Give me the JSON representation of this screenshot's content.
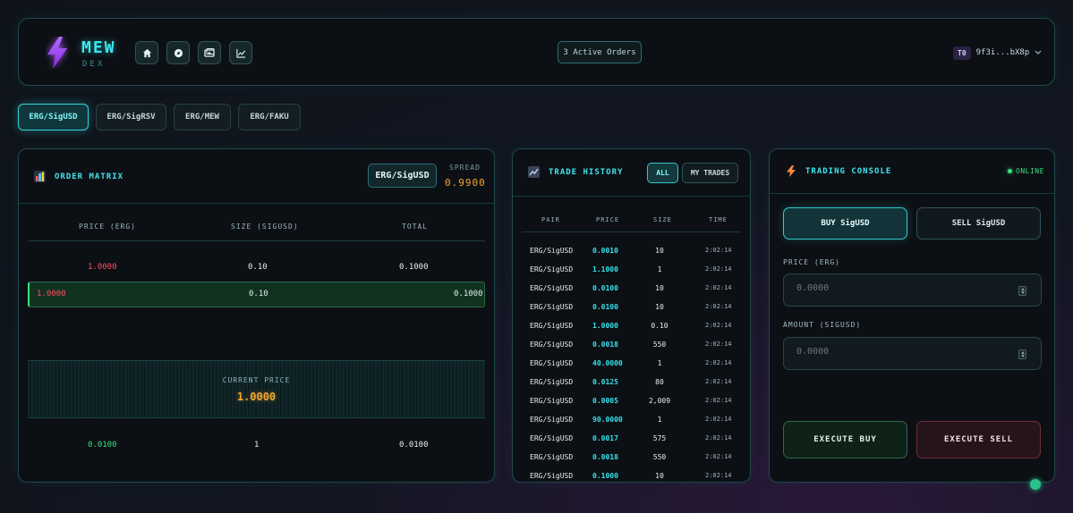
{
  "header": {
    "logo_title": "MEW",
    "logo_subtitle": "DEX",
    "active_orders": "3 Active Orders",
    "wallet_badge": "T0",
    "wallet_address": "9f3i...bX8p",
    "nav_icons": [
      "home-icon",
      "compass-icon",
      "wallet-icon",
      "chart-icon"
    ]
  },
  "pairs": [
    "ERG/SigUSD",
    "ERG/SigRSV",
    "ERG/MEW",
    "ERG/FAKU"
  ],
  "active_pair_index": 0,
  "order_matrix": {
    "title": "ORDER MATRIX",
    "pair": "ERG/SigUSD",
    "spread_label": "SPREAD",
    "spread_value": "0.9900",
    "columns": [
      "PRICE (ERG)",
      "SIZE (SIGUSD)",
      "TOTAL"
    ],
    "asks": [
      {
        "price": "1.0000",
        "size": "0.10",
        "total": "0.1000"
      },
      {
        "price": "1.0000",
        "size": "0.10",
        "total": "0.1000"
      }
    ],
    "current_label": "CURRENT PRICE",
    "current_price": "1.0000",
    "bids": [
      {
        "price": "0.0100",
        "size": "1",
        "total": "0.0100"
      }
    ]
  },
  "trade_history": {
    "title": "TRADE HISTORY",
    "filter_all": "ALL",
    "filter_mine": "MY TRADES",
    "columns": [
      "PAIR",
      "PRICE",
      "SIZE",
      "TIME"
    ],
    "rows": [
      {
        "pair": "ERG/SigUSD",
        "price": "0.0010",
        "size": "10",
        "time": "2:02:14"
      },
      {
        "pair": "ERG/SigUSD",
        "price": "1.1000",
        "size": "1",
        "time": "2:02:14"
      },
      {
        "pair": "ERG/SigUSD",
        "price": "0.0100",
        "size": "10",
        "time": "2:02:14"
      },
      {
        "pair": "ERG/SigUSD",
        "price": "0.0100",
        "size": "10",
        "time": "2:02:14"
      },
      {
        "pair": "ERG/SigUSD",
        "price": "1.0000",
        "size": "0.10",
        "time": "2:02:14"
      },
      {
        "pair": "ERG/SigUSD",
        "price": "0.0018",
        "size": "550",
        "time": "2:02:14"
      },
      {
        "pair": "ERG/SigUSD",
        "price": "40.0000",
        "size": "1",
        "time": "2:02:14"
      },
      {
        "pair": "ERG/SigUSD",
        "price": "0.0125",
        "size": "80",
        "time": "2:02:14"
      },
      {
        "pair": "ERG/SigUSD",
        "price": "0.0005",
        "size": "2,009",
        "time": "2:02:14"
      },
      {
        "pair": "ERG/SigUSD",
        "price": "90.0000",
        "size": "1",
        "time": "2:02:14"
      },
      {
        "pair": "ERG/SigUSD",
        "price": "0.0017",
        "size": "575",
        "time": "2:02:14"
      },
      {
        "pair": "ERG/SigUSD",
        "price": "0.0018",
        "size": "550",
        "time": "2:02:14"
      },
      {
        "pair": "ERG/SigUSD",
        "price": "0.1000",
        "size": "10",
        "time": "2:02:14"
      }
    ]
  },
  "console": {
    "title": "TRADING CONSOLE",
    "status": "ONLINE",
    "buy_tab": "BUY SigUSD",
    "sell_tab": "SELL SigUSD",
    "price_label": "PRICE (ERG)",
    "price_placeholder": "0.0000",
    "amount_label": "AMOUNT (SIGUSD)",
    "amount_placeholder": "0.0000",
    "execute_buy": "EXECUTE BUY",
    "execute_sell": "EXECUTE SELL"
  },
  "colors": {
    "accent": "#3ee6ee",
    "ask": "#ff4d5e",
    "bid": "#3be07c",
    "price_highlight": "#f0a733"
  }
}
